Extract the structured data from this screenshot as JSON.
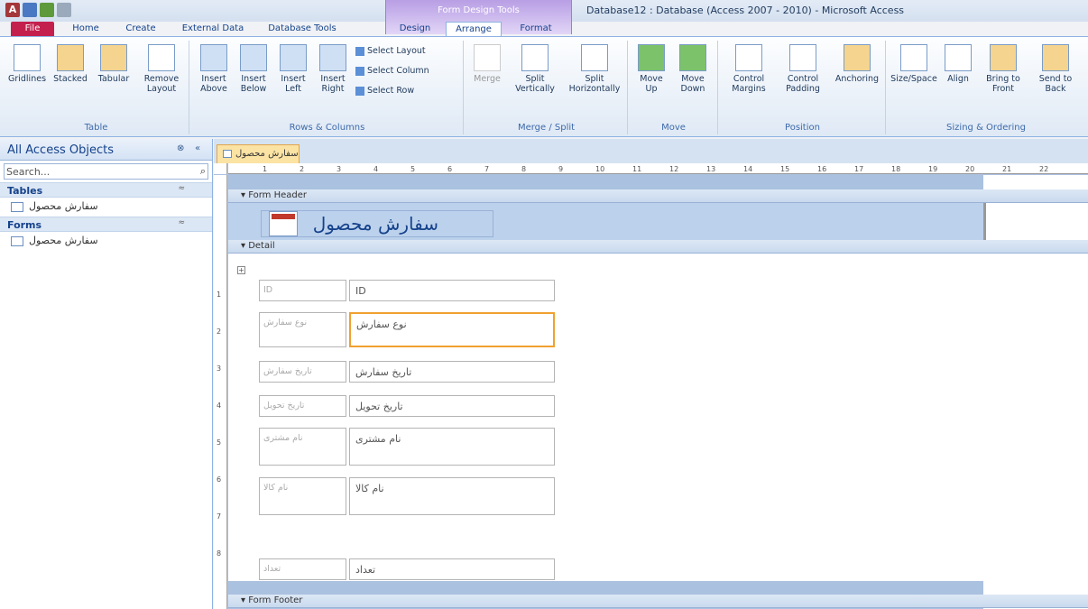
{
  "titlebar": {
    "context_tab_group": "Form Design Tools",
    "window_title": "Database12 : Database (Access 2007 - 2010) - Microsoft Access"
  },
  "tabs": [
    "File",
    "Home",
    "Create",
    "External Data",
    "Database Tools",
    "Design",
    "Arrange",
    "Format"
  ],
  "ribbon": {
    "table": {
      "label": "Table",
      "buttons": [
        "Gridlines",
        "Stacked",
        "Tabular",
        "Remove Layout"
      ]
    },
    "rows_columns": {
      "label": "Rows & Columns",
      "buttons": [
        "Insert Above",
        "Insert Below",
        "Insert Left",
        "Insert Right"
      ],
      "small": [
        "Select Layout",
        "Select Column",
        "Select Row"
      ]
    },
    "merge_split": {
      "label": "Merge / Split",
      "buttons": [
        "Merge",
        "Split Vertically",
        "Split Horizontally"
      ]
    },
    "move": {
      "label": "Move",
      "buttons": [
        "Move Up",
        "Move Down"
      ]
    },
    "position": {
      "label": "Position",
      "buttons": [
        "Control Margins",
        "Control Padding",
        "Anchoring"
      ]
    },
    "sizing": {
      "label": "Sizing & Ordering",
      "buttons": [
        "Size/Space",
        "Align",
        "Bring to Front",
        "Send to Back"
      ]
    }
  },
  "nav": {
    "title": "All Access Objects",
    "search_placeholder": "Search...",
    "tables_label": "Tables",
    "forms_label": "Forms",
    "tables": [
      "سفارش محصول"
    ],
    "forms": [
      "سفارش محصول"
    ]
  },
  "document": {
    "tab_label": "سفارش محصول",
    "ruler_ticks": [
      "1",
      "2",
      "3",
      "4",
      "5",
      "6",
      "7",
      "8",
      "9",
      "10",
      "11",
      "12",
      "13",
      "14",
      "15",
      "16",
      "17",
      "18",
      "19",
      "20",
      "21",
      "22"
    ],
    "vruler_ticks": [
      "1",
      "2",
      "3",
      "4",
      "5",
      "6",
      "7",
      "8"
    ],
    "sections": {
      "header": "Form Header",
      "detail": "Detail",
      "footer": "Form Footer"
    },
    "form_title": "سفارش محصول",
    "fields": [
      {
        "label": "ID",
        "value": "ID"
      },
      {
        "label": "نوع سفارش",
        "value": "نوع سفارش"
      },
      {
        "label": "تاریخ سفارش",
        "value": "تاریخ سفارش"
      },
      {
        "label": "تاریخ تحویل",
        "value": "تاریخ تحویل"
      },
      {
        "label": "نام مشتری",
        "value": "نام مشتری"
      },
      {
        "label": "نام کالا",
        "value": "نام کالا"
      },
      {
        "label": "تعداد",
        "value": "تعداد"
      }
    ]
  }
}
